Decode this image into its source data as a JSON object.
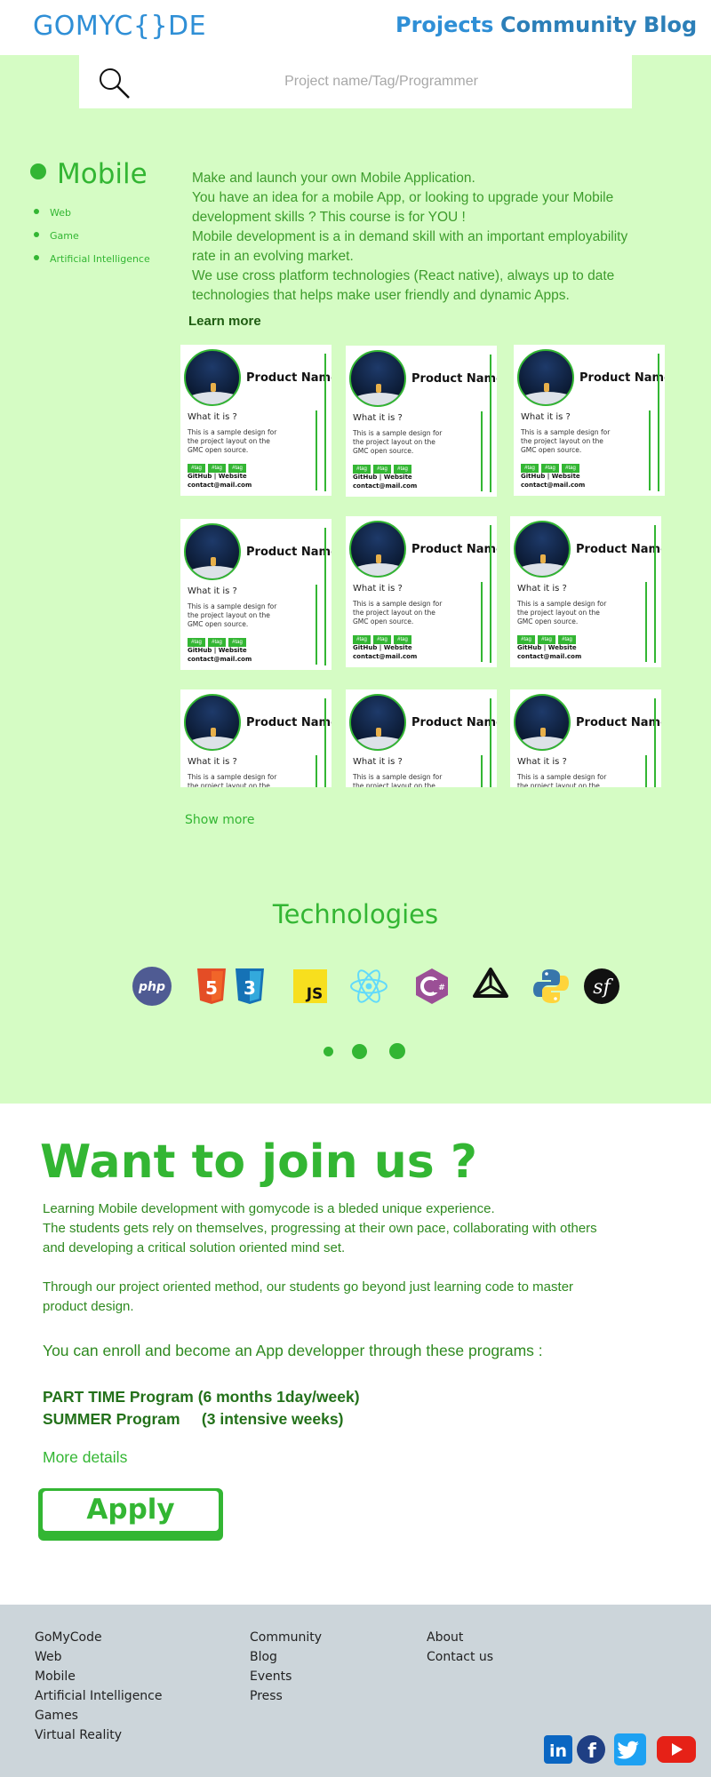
{
  "header": {
    "logo": "GOMYC{}DE",
    "nav": [
      "Projects",
      "Community",
      "Blog"
    ]
  },
  "search": {
    "placeholder": "Project name/Tag/Programmer"
  },
  "sidebar": {
    "title": "Mobile",
    "items": [
      "Web",
      "Game",
      "Artificial Intelligence"
    ]
  },
  "intro": {
    "paragraphs": [
      "Make and launch your own Mobile Application.",
      "You have an idea for a mobile App, or looking to upgrade your Mobile development skills ? This course is for YOU !",
      "Mobile development is a in demand skill with an important employability rate in an evolving market.",
      "We use cross platform technologies (React native), always up to date technologies that helps make user friendly and dynamic Apps."
    ],
    "learn_more": "Learn more"
  },
  "card": {
    "product_name": "Product Name",
    "what": "What it is ?",
    "description": "This is a sample design for the project layout on the GMC open source.",
    "tag": "#tag",
    "links": "GitHub | Website",
    "email": "contact@mail.com"
  },
  "show_more": "Show more",
  "technologies": {
    "title": "Technologies",
    "icons": [
      "php-icon",
      "html5-icon",
      "css3-icon",
      "javascript-icon",
      "react-icon",
      "csharp-icon",
      "unity-icon",
      "python-icon",
      "symfony-icon"
    ],
    "php_label": "php",
    "js_label": "JS"
  },
  "join": {
    "title": "Want to join us ?",
    "p1": "Learning Mobile development with gomycode is a bleded unique experience.",
    "p2": "The students gets rely on themselves, progressing at their own pace, collaborating with others and developing a critical solution oriented mind set.",
    "p3": "Through our project oriented method, our students go beyond just learning code to master product design.",
    "enroll": "You can enroll and become an App developper through these programs :",
    "program1": "PART TIME Program (6 months 1day/week)",
    "program2": "SUMMER Program     (3 intensive weeks)",
    "more_details": "More details",
    "apply": "Apply"
  },
  "footer": {
    "col1": [
      "GoMyCode",
      "Web",
      "Mobile",
      "Artificial Intelligence",
      "Games",
      "Virtual Reality"
    ],
    "col2": [
      "Community",
      "Blog",
      "Events",
      "Press"
    ],
    "col3": [
      "About",
      "Contact us"
    ],
    "social": [
      "linkedin-icon",
      "facebook-icon",
      "twitter-icon",
      "youtube-icon"
    ],
    "linkedin_label": "in",
    "facebook_label": "f"
  },
  "colors": {
    "accent_green": "#33b633",
    "bg_green": "#d5fcc4",
    "nav_blue": "#2f8fd6",
    "footer_bg": "#ccd5da"
  }
}
